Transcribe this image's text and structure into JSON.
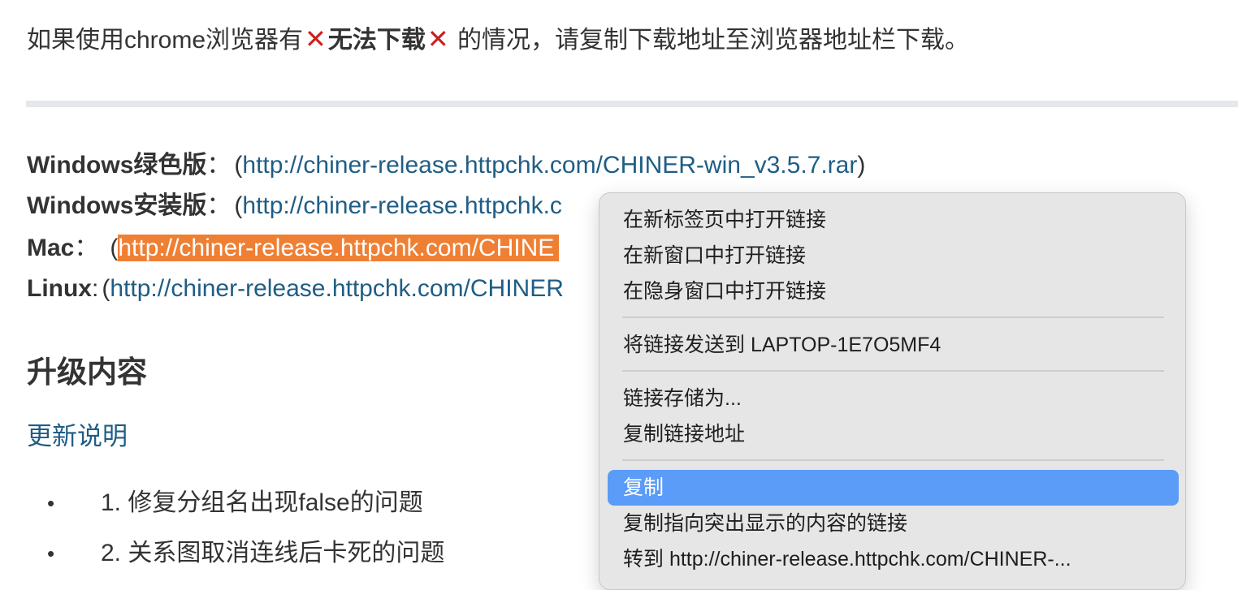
{
  "notice": {
    "prefix": "如果使用chrome浏览器有",
    "x_glyph": "✕",
    "bold": "无法下载",
    "suffix": " 的情况，请复制下载地址至浏览器地址栏下载。"
  },
  "downloads": [
    {
      "label": "Windows绿色版",
      "colon": "：",
      "open": "(",
      "url": "http://chiner-release.httpchk.com/CHINER-win_v3.5.7.rar",
      "close": ")"
    },
    {
      "label": "Windows安装版",
      "colon": "：",
      "open": "(",
      "url": "http://chiner-release.httpchk.c",
      "close": ""
    },
    {
      "label": "Mac",
      "colon": "：",
      "open": "(",
      "url": "http://chiner-release.httpchk.com/CHINE",
      "close": ""
    },
    {
      "label": "Linux",
      "colon": ":",
      "open": "(",
      "url": "http://chiner-release.httpchk.com/CHINER",
      "close": ""
    }
  ],
  "heading": "升级内容",
  "changelog_link": "更新说明",
  "list_items": [
    {
      "bullet": "•",
      "text": "1. 修复分组名出现false的问题"
    },
    {
      "bullet": "•",
      "text": "2. 关系图取消连线后卡死的问题"
    }
  ],
  "context_menu": {
    "items": [
      "在新标签页中打开链接",
      "在新窗口中打开链接",
      "在隐身窗口中打开链接",
      "将链接发送到 LAPTOP-1E7O5MF4",
      "链接存储为...",
      "复制链接地址",
      "复制",
      "复制指向突出显示的内容的链接",
      "转到 http://chiner-release.httpchk.com/CHINER-..."
    ],
    "active_item": "复制"
  },
  "colors": {
    "link": "#1f5d85",
    "selection": "#ef7f33",
    "menu_highlight": "#5a9cf8",
    "error_x": "#c8211e"
  }
}
